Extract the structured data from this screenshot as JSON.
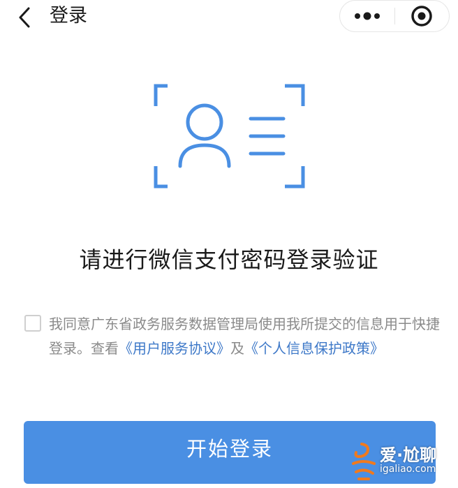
{
  "header": {
    "title": "登录"
  },
  "main": {
    "prompt": "请进行微信支付密码登录验证",
    "agreement": {
      "text_before": "我同意广东省政务服务数据管理局使用我所提交的信息用于快捷登录。查看",
      "link1": "《用户服务协议》",
      "text_between": "及",
      "link2": "《个人信息保护政策》"
    },
    "start_button": "开始登录"
  },
  "watermark": {
    "title": "爱·尬聊",
    "url": "igaliao.com"
  },
  "colors": {
    "accent": "#4a8fe3",
    "link": "#3d78c8",
    "icon_blue": "#4a8fe3",
    "text_gray": "#8a8a8a",
    "watermark_orange": "#f07a1e"
  },
  "icons": {
    "back": "chevron-left-icon",
    "more": "more-dots-icon",
    "close": "target-circle-icon",
    "face_id": "face-id-icon"
  }
}
